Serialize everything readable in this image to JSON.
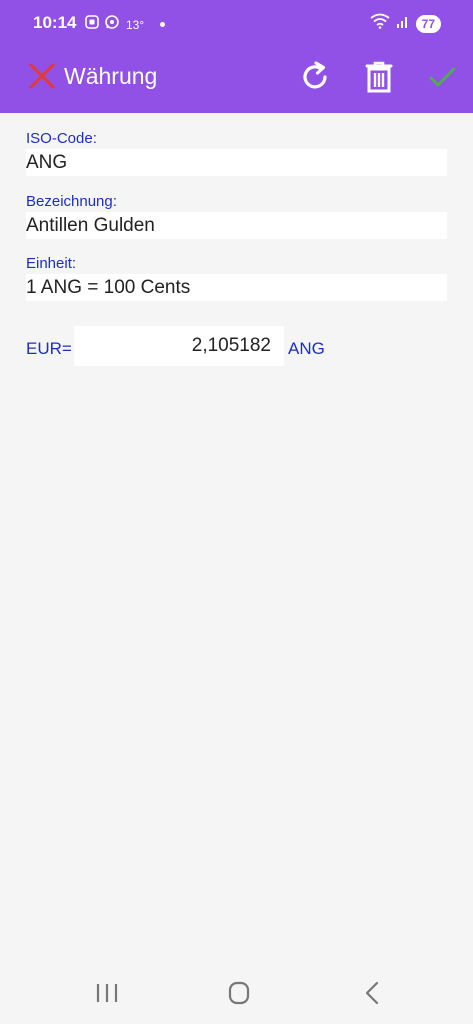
{
  "status": {
    "time": "10:14",
    "temperature": "13°",
    "battery": "77"
  },
  "appbar": {
    "title": "Währung",
    "close_icon": "close-icon",
    "refresh_icon": "refresh-icon",
    "delete_icon": "trash-icon",
    "confirm_icon": "check-icon",
    "bar_color": "#9150e6"
  },
  "form": {
    "iso_label": "ISO-Code:",
    "iso_value": "ANG",
    "name_label": "Bezeichnung:",
    "name_value": "Antillen Gulden",
    "unit_label": "Einheit:",
    "unit_value": "1 ANG = 100 Cents"
  },
  "rate": {
    "prefix": "EUR=",
    "value": "2,105182",
    "suffix": "ANG"
  },
  "colors": {
    "accent": "#9150e6",
    "label": "#1e2fbf",
    "close": "#e53935",
    "confirm": "#4caf50"
  }
}
